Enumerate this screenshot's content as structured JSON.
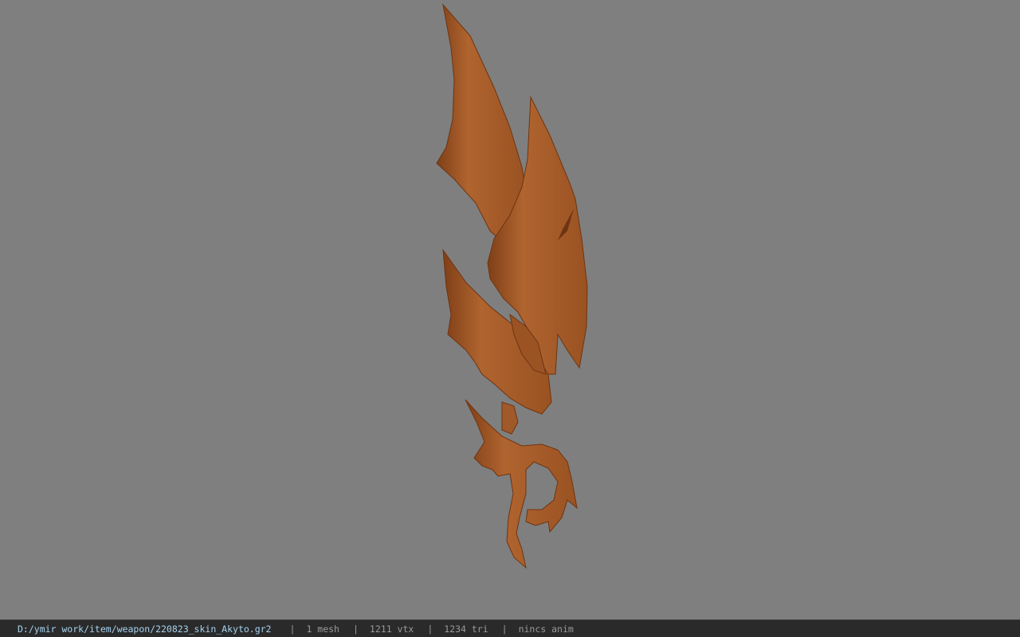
{
  "viewer": {
    "background_color": "#7f7f7f",
    "model_color": "#a85c2c",
    "model_icon": "weapon-blade-model"
  },
  "status": {
    "file_path": "D:/ymir work/item/weapon/220823_skin_Akyto.gr2",
    "separator": "|",
    "mesh_count": "1 mesh",
    "vertex_count": "1211 vtx",
    "triangle_count": "1234 tri",
    "anim_status": "nincs anim"
  }
}
